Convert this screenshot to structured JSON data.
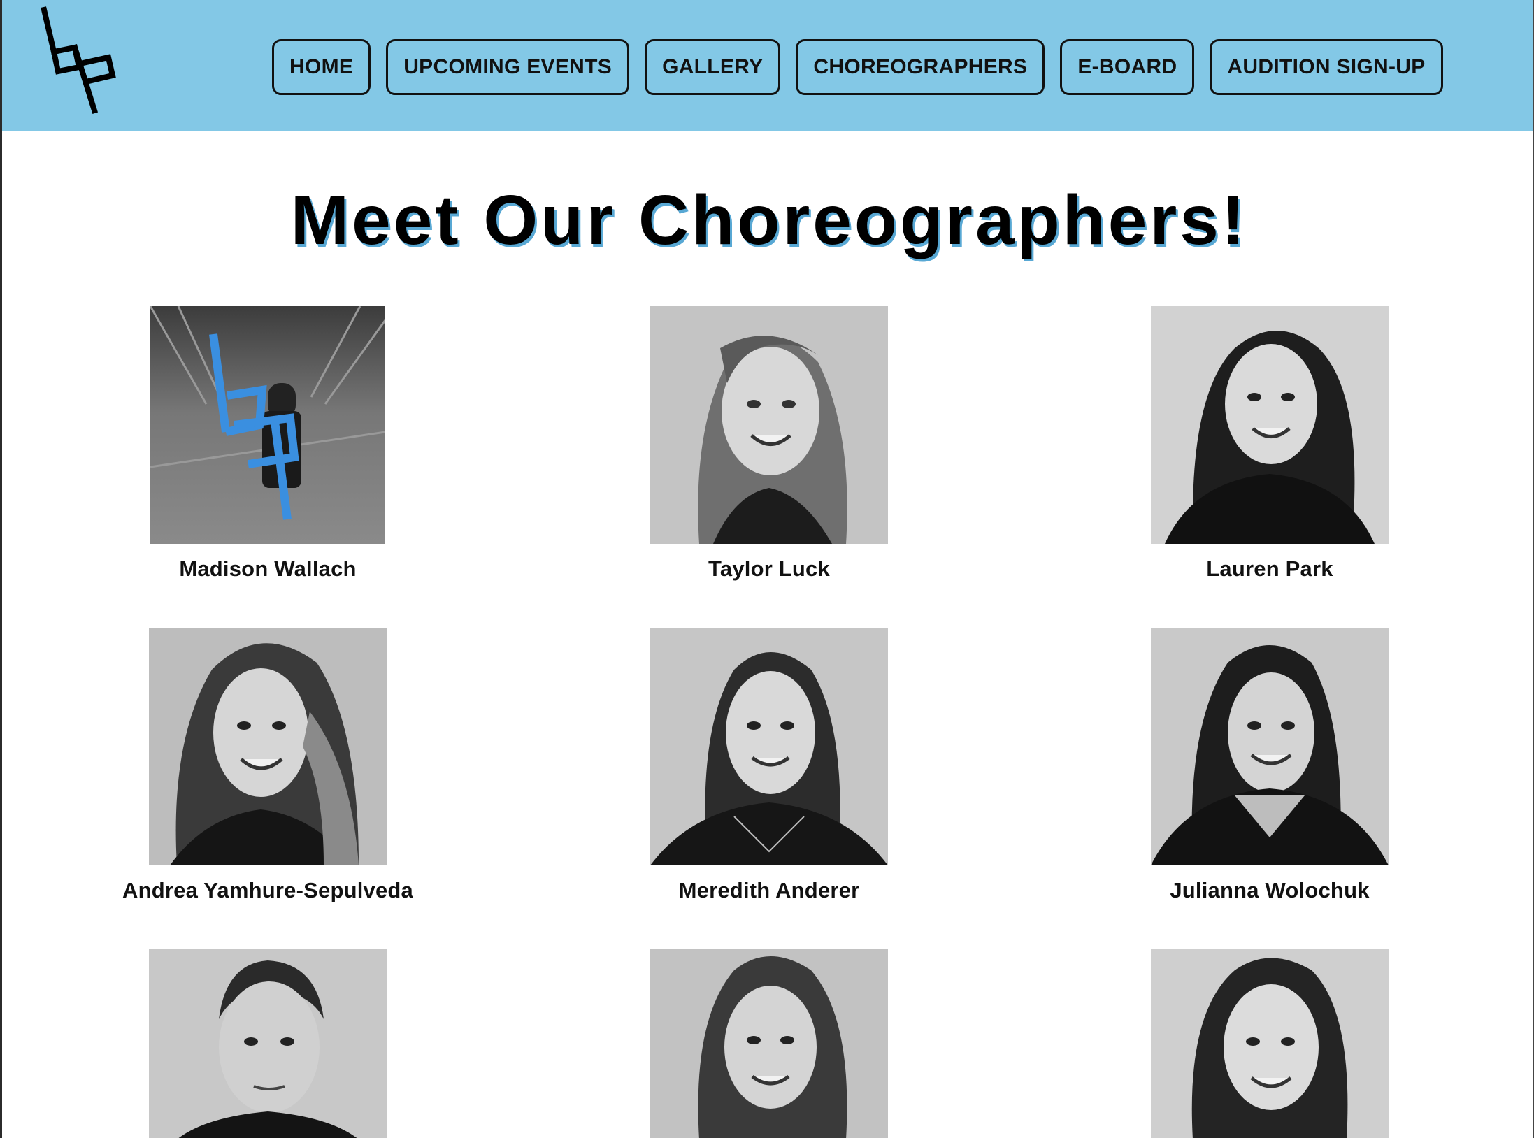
{
  "nav": {
    "items": [
      {
        "label": "HOME"
      },
      {
        "label": "UPCOMING EVENTS"
      },
      {
        "label": "GALLERY"
      },
      {
        "label": "CHOREOGRAPHERS"
      },
      {
        "label": "E-BOARD"
      },
      {
        "label": "AUDITION SIGN-UP"
      }
    ]
  },
  "page": {
    "title": "Meet Our Choreographers!"
  },
  "colors": {
    "nav_background": "#83c8e6",
    "accent_blue": "#3a8fe0",
    "title_shadow": "#58a8d4"
  },
  "choreographers": [
    {
      "name": "Madison Wallach",
      "photo": "outdoor-photo-with-logo-overlay"
    },
    {
      "name": "Taylor Luck",
      "photo": "headshot"
    },
    {
      "name": "Lauren Park",
      "photo": "headshot"
    },
    {
      "name": "Andrea Yamhure-Sepulveda",
      "photo": "headshot"
    },
    {
      "name": "Meredith Anderer",
      "photo": "headshot"
    },
    {
      "name": "Julianna Wolochuk",
      "photo": "headshot"
    },
    {
      "name": "",
      "photo": "headshot"
    },
    {
      "name": "",
      "photo": "headshot"
    },
    {
      "name": "",
      "photo": "headshot"
    }
  ]
}
